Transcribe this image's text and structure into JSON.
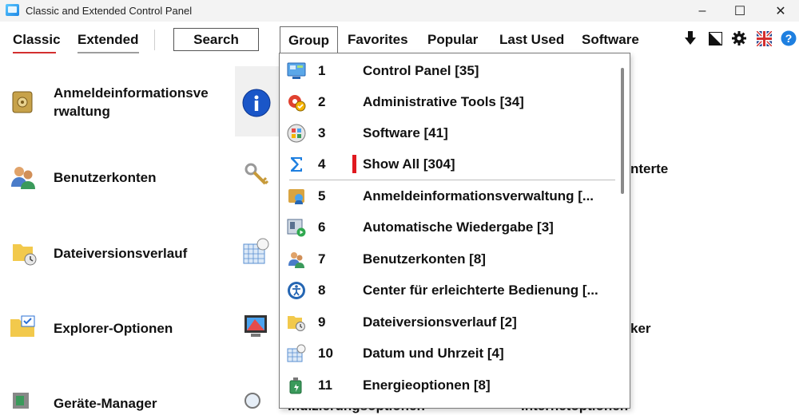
{
  "window": {
    "title": "Classic and Extended Control Panel",
    "minimize": "–",
    "maximize": "☐",
    "close": "✕"
  },
  "toolbar": {
    "tabs": [
      "Classic",
      "Extended"
    ],
    "search_label": "Search",
    "group_label": "Group",
    "menus": [
      "Favorites",
      "Popular",
      "Last Used",
      "Software"
    ],
    "accent_color": "#d32f2f",
    "icons": [
      "download-icon",
      "contrast-icon",
      "gear-icon",
      "uk-flag-icon",
      "help-icon"
    ]
  },
  "background_items": {
    "col1": [
      "Anmeldeinformationsve rwaltung",
      "Benutzerkonten",
      "Dateiversionsverlauf",
      "Explorer-Optionen",
      "Geräte-Manager"
    ],
    "partial": [
      "nterte",
      "ker",
      "Internetoptionen",
      "Indizierungsoptionen"
    ]
  },
  "dropdown": {
    "items": [
      {
        "num": "1",
        "label": "Control Panel [35]",
        "icon": "control-panel-icon"
      },
      {
        "num": "2",
        "label": "Administrative Tools [34]",
        "icon": "admin-tools-icon"
      },
      {
        "num": "3",
        "label": "Software [41]",
        "icon": "software-icon"
      },
      {
        "num": "4",
        "label": "Show All [304]",
        "icon": "sigma-icon"
      },
      {
        "num": "5",
        "label": "Anmeldeinformationsverwaltung [...",
        "icon": "credential-icon"
      },
      {
        "num": "6",
        "label": "Automatische Wiedergabe [3]",
        "icon": "autoplay-icon"
      },
      {
        "num": "7",
        "label": "Benutzerkonten [8]",
        "icon": "users-icon"
      },
      {
        "num": "8",
        "label": "Center für erleichterte Bedienung [...",
        "icon": "ease-of-access-icon"
      },
      {
        "num": "9",
        "label": "Dateiversionsverlauf [2]",
        "icon": "file-history-icon"
      },
      {
        "num": "10",
        "label": "Datum und Uhrzeit [4]",
        "icon": "date-time-icon"
      },
      {
        "num": "11",
        "label": "Energieoptionen [8]",
        "icon": "power-icon"
      }
    ]
  }
}
